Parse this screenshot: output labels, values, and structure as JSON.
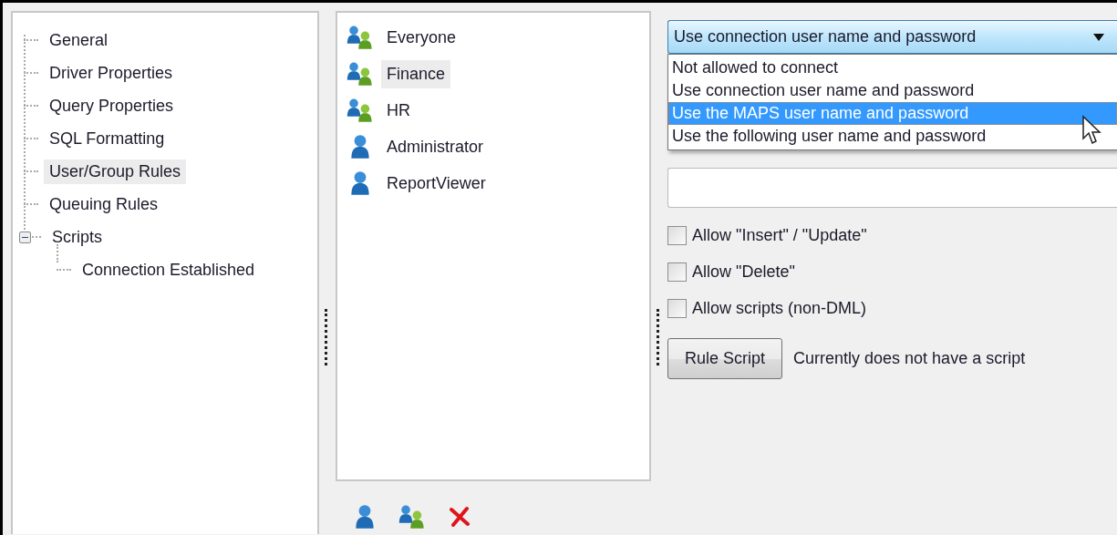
{
  "tree": {
    "items": [
      {
        "label": "General",
        "selected": false
      },
      {
        "label": "Driver Properties",
        "selected": false
      },
      {
        "label": "Query Properties",
        "selected": false
      },
      {
        "label": "SQL Formatting",
        "selected": false
      },
      {
        "label": "User/Group Rules",
        "selected": true
      },
      {
        "label": "Queuing Rules",
        "selected": false
      },
      {
        "label": "Scripts",
        "selected": false,
        "expanded": true,
        "children": [
          {
            "label": "Connection Established",
            "selected": false
          }
        ]
      }
    ]
  },
  "principals": {
    "items": [
      {
        "kind": "group",
        "label": "Everyone",
        "selected": false
      },
      {
        "kind": "group",
        "label": "Finance",
        "selected": true
      },
      {
        "kind": "group",
        "label": "HR",
        "selected": false
      },
      {
        "kind": "user",
        "label": "Administrator",
        "selected": false
      },
      {
        "kind": "user",
        "label": "ReportViewer",
        "selected": false
      }
    ],
    "toolbar": [
      {
        "kind": "user"
      },
      {
        "kind": "group"
      },
      {
        "kind": "delete"
      }
    ]
  },
  "rule": {
    "auth_mode": {
      "value": "Use connection user name and password",
      "expanded": true,
      "options": [
        {
          "label": "Not allowed to connect",
          "highlighted": false
        },
        {
          "label": "Use connection user name and password",
          "highlighted": false
        },
        {
          "label": "Use the MAPS user name and password",
          "highlighted": true
        },
        {
          "label": "Use the following user name and password",
          "highlighted": false
        }
      ]
    },
    "permissions": [
      {
        "label": "Allow \"Insert\" / \"Update\"",
        "checked": false
      },
      {
        "label": "Allow \"Delete\"",
        "checked": false
      },
      {
        "label": "Allow scripts (non-DML)",
        "checked": false
      }
    ],
    "script_button": "Rule Script",
    "script_status": "Currently does not have a script"
  }
}
